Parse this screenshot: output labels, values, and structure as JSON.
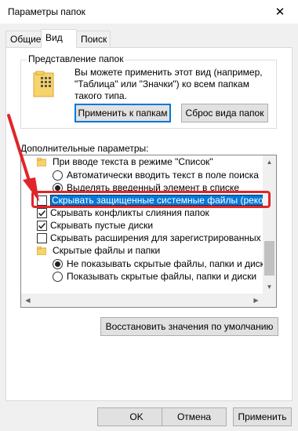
{
  "window": {
    "title": "Параметры папок",
    "close_glyph": "✕"
  },
  "tabs": [
    {
      "label": "Общие",
      "active": false
    },
    {
      "label": "Вид",
      "active": true
    },
    {
      "label": "Поиск",
      "active": false
    }
  ],
  "folder_views": {
    "group_title": "Представление папок",
    "description": "Вы можете применить этот вид (например, \"Таблица\" или \"Значки\") ко всем папкам такого типа.",
    "apply_button": "Применить к папкам",
    "reset_button": "Сброс вида папок"
  },
  "advanced": {
    "label": "Дополнительные параметры:",
    "items": [
      {
        "type": "folder",
        "label": "При вводе текста в режиме \"Список\""
      },
      {
        "type": "radio",
        "checked": false,
        "label": "Автоматически вводить текст в поле поиска"
      },
      {
        "type": "radio",
        "checked": true,
        "label": "Выделять введенный элемент в списке"
      },
      {
        "type": "checkbox",
        "checked": false,
        "selected": true,
        "label": "Скрывать защищенные системные файлы (рекомен,"
      },
      {
        "type": "checkbox",
        "checked": true,
        "label": "Скрывать конфликты слияния папок"
      },
      {
        "type": "checkbox",
        "checked": true,
        "label": "Скрывать пустые диски"
      },
      {
        "type": "checkbox",
        "checked": false,
        "label": "Скрывать расширения для зарегистрированных типо"
      },
      {
        "type": "folder",
        "label": "Скрытые файлы и папки"
      },
      {
        "type": "radio",
        "checked": true,
        "label": "Не показывать скрытые файлы, папки и диски"
      },
      {
        "type": "radio",
        "checked": false,
        "label": "Показывать скрытые файлы, папки и диски"
      }
    ],
    "restore_button": "Восстановить значения по умолчанию"
  },
  "footer": {
    "ok": "OK",
    "cancel": "Отмена",
    "apply": "Применить"
  },
  "colors": {
    "highlight": "#e0252a",
    "selection": "#0078d7"
  }
}
